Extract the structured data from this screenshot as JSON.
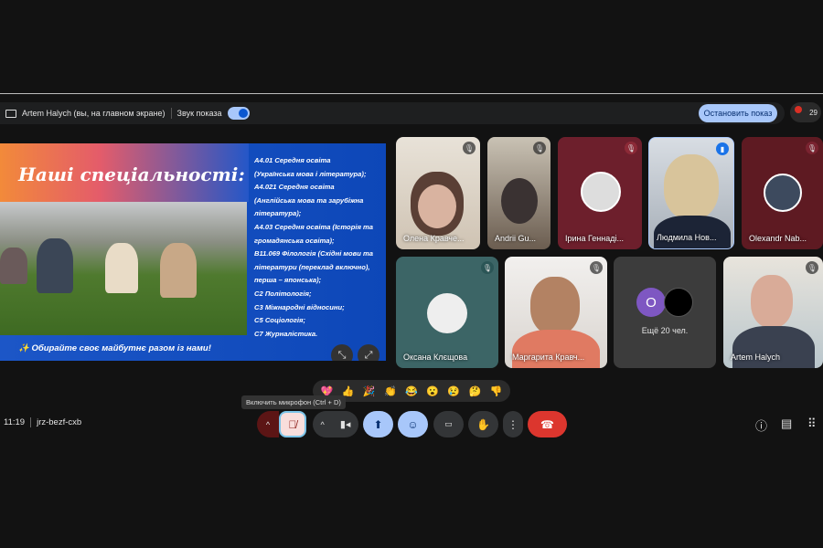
{
  "share_bar": {
    "presenter": "Artem Halych (вы, на главном экране)",
    "sound_label": "Звук показа",
    "sound_on": true,
    "stop_label": "Остановить показ",
    "participant_count": "29"
  },
  "slide": {
    "title": "Наші спеціальності:",
    "footer": "✨ Обирайте своє майбутнє разом із нами!",
    "lines": [
      "А4.01 Середня освіта",
      "(Українська мова і література);",
      "А4.021 Середня освіта",
      "(Англійська мова та зарубіжна",
      "література);",
      "А4.03 Середня освіта (Історія та",
      "громадянська освіта);",
      "В11.069 Філологія (Східні мови та",
      "літератури (переклад включно),",
      "перша – японська);",
      "С2 Політологія;",
      "С3 Міжнародні відносини;",
      "С5 Соціологія;",
      "С7 Журналістика."
    ]
  },
  "participants": [
    {
      "name": "Олена Кравче...",
      "muted": true
    },
    {
      "name": "Andrii Gu...",
      "muted": true
    },
    {
      "name": "Ірина Геннаді...",
      "muted": true
    },
    {
      "name": "Людмила Нов...",
      "speaking": true
    },
    {
      "name": "Olexandr Nab...",
      "muted": true
    },
    {
      "name": "Оксана Клєщова",
      "muted": true
    },
    {
      "name": "Маргарита Кравч...",
      "muted": true
    },
    {
      "name": "Artem Halych",
      "muted": true
    }
  ],
  "more": {
    "label": "Ещё 20 чел.",
    "avatar_letter": "O",
    "avatar_color": "#7e57c2"
  },
  "reactions": [
    "💖",
    "👍",
    "🎉",
    "👏",
    "😂",
    "😮",
    "😢",
    "🤔",
    "👎"
  ],
  "tooltip": "Включить микрофон (Ctrl + D)",
  "meeting": {
    "time": "11:19",
    "code": "jrz-bezf-cxb"
  },
  "colors": {
    "accent": "#a8c7fa",
    "end_call": "#dc362e",
    "mic_off_bg": "#f9dedc"
  }
}
